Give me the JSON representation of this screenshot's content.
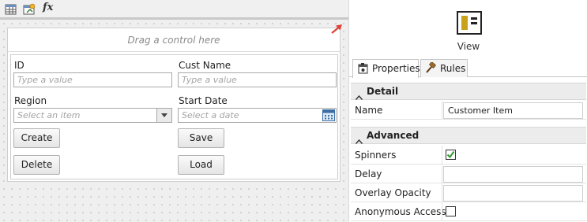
{
  "toolbar": {
    "icons": [
      "table-grid-icon",
      "add-item-icon",
      "expression-fx-icon"
    ],
    "fx_label": "fx"
  },
  "canvas": {
    "dropzone_text": "Drag a control here"
  },
  "form": {
    "id_label": "ID",
    "id_placeholder": "Type a value",
    "cust_name_label": "Cust Name",
    "cust_name_placeholder": "Type a value",
    "region_label": "Region",
    "region_placeholder": "Select an item",
    "start_date_label": "Start Date",
    "start_date_placeholder": "Select a date",
    "create_label": "Create",
    "save_label": "Save",
    "delete_label": "Delete",
    "load_label": "Load"
  },
  "panel": {
    "view_label": "View",
    "tabs": [
      {
        "label": "Properties",
        "active": true
      },
      {
        "label": "Rules",
        "active": false
      }
    ],
    "sections": [
      {
        "title": "Detail"
      },
      {
        "title": "Advanced"
      }
    ],
    "detail": {
      "name_label": "Name",
      "name_value": "Customer Item"
    },
    "advanced": {
      "spinners_label": "Spinners",
      "spinners_checked": true,
      "delay_label": "Delay",
      "delay_value": "",
      "overlay_label": "Overlay Opacity",
      "overlay_value": "",
      "anon_label": "Anonymous Access",
      "anon_checked": false
    }
  },
  "colors": {
    "check_green": "#2e9a2e",
    "arrow_red": "#e0413a",
    "view_icon_yellow": "#c9a21b"
  }
}
